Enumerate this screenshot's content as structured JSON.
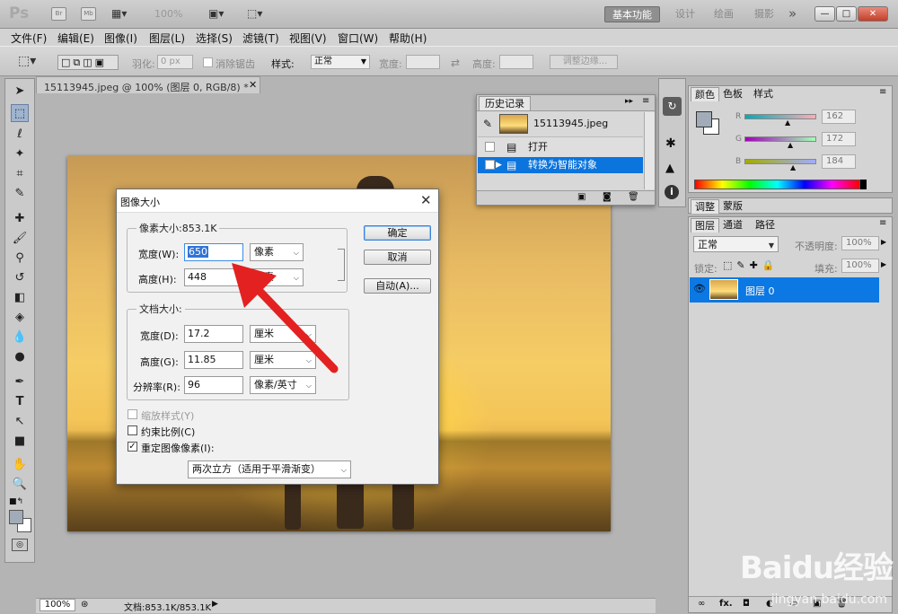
{
  "app": {
    "logo": "Ps",
    "bridge_icon": "Br",
    "minibridge_icon": "Mb",
    "zoom": "100%"
  },
  "workspaces": [
    "基本功能",
    "设计",
    "绘画",
    "摄影"
  ],
  "workspace_more": "»",
  "menu": [
    "文件(F)",
    "编辑(E)",
    "图像(I)",
    "图层(L)",
    "选择(S)",
    "滤镜(T)",
    "视图(V)",
    "窗口(W)",
    "帮助(H)"
  ],
  "options": {
    "feather_label": "羽化:",
    "feather_value": "0 px",
    "antialias_label": "消除锯齿",
    "style_label": "样式:",
    "style_value": "正常",
    "width_label": "宽度:",
    "height_label": "高度:",
    "refine_edge": "调整边缘..."
  },
  "document": {
    "tab_title": "15113945.jpeg @ 100% (图层 0, RGB/8) *",
    "zoom": "100%",
    "info": "文档:853.1K/853.1K"
  },
  "history": {
    "tab": "历史记录",
    "snapshot": "15113945.jpeg",
    "rows": [
      "打开",
      "转换为智能对象"
    ]
  },
  "dialog": {
    "title": "图像大小",
    "pixel_group": "像素大小:853.1K",
    "width_label": "宽度(W):",
    "width_value": "650",
    "width_unit": "像素",
    "height_label": "高度(H):",
    "height_value": "448",
    "height_unit": "像素",
    "doc_group": "文档大小:",
    "doc_width_label": "宽度(D):",
    "doc_width_value": "17.2",
    "doc_width_unit": "厘米",
    "doc_height_label": "高度(G):",
    "doc_height_value": "11.85",
    "doc_height_unit": "厘米",
    "res_label": "分辨率(R):",
    "res_value": "96",
    "res_unit": "像素/英寸",
    "scale_styles": "缩放样式(Y)",
    "constrain": "约束比例(C)",
    "resample": "重定图像像素(I):",
    "resample_method": "两次立方（适用于平滑渐变）",
    "ok": "确定",
    "cancel": "取消",
    "auto": "自动(A)..."
  },
  "color_panel": {
    "tabs": [
      "颜色",
      "色板",
      "样式"
    ],
    "r_label": "R",
    "r_value": "162",
    "g_label": "G",
    "g_value": "172",
    "b_label": "B",
    "b_value": "184",
    "fg": "#a2acb8"
  },
  "adjust_panel": {
    "tabs": [
      "调整",
      "蒙版"
    ]
  },
  "layers_panel": {
    "tabs": [
      "图层",
      "通道",
      "路径"
    ],
    "blend": "正常",
    "opacity_label": "不透明度:",
    "opacity": "100%",
    "lock_label": "锁定:",
    "fill_label": "填充:",
    "fill": "100%",
    "layer_name": "图层 0",
    "fx": "fx."
  },
  "watermark": {
    "brand": "Baidu经验",
    "url": "jingyan.baidu.com"
  },
  "colors": {
    "selection": "#0a6fd8",
    "layer_selected": "#0b78e3",
    "arrow": "#e32121"
  }
}
